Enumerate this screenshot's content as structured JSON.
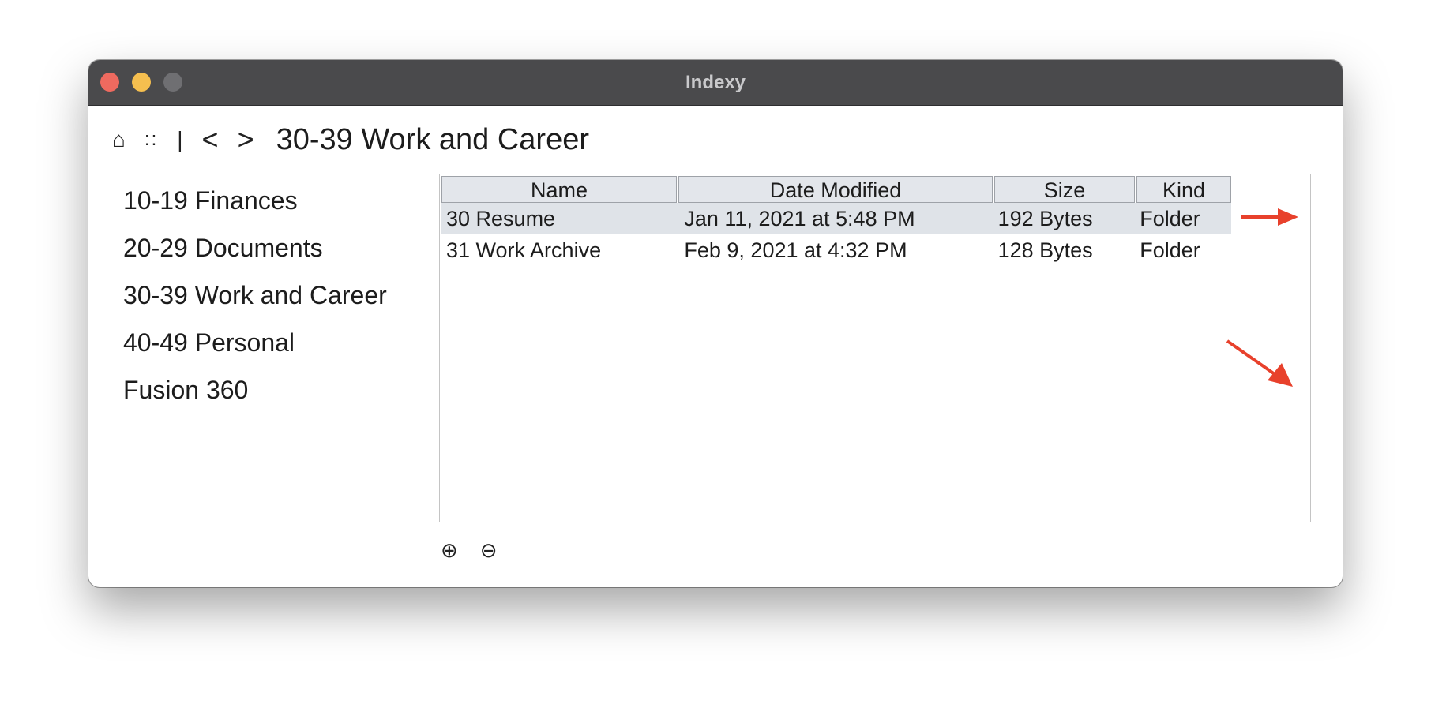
{
  "window": {
    "title": "Indexy"
  },
  "toolbar": {
    "home_glyph": "⌂",
    "grid_glyph": "::",
    "separator_glyph": "|",
    "back_glyph": "<",
    "forward_glyph": ">",
    "current_path": "30-39 Work and Career"
  },
  "sidebar": {
    "items": [
      {
        "label": "10-19 Finances"
      },
      {
        "label": "20-29 Documents"
      },
      {
        "label": "30-39 Work and Career"
      },
      {
        "label": "40-49 Personal"
      },
      {
        "label": "Fusion 360"
      }
    ]
  },
  "table": {
    "columns": [
      "Name",
      "Date Modified",
      "Size",
      "Kind"
    ],
    "rows": [
      {
        "name": "30 Resume",
        "date": "Jan 11, 2021 at 5:48 PM",
        "size": "192 Bytes",
        "kind": "Folder",
        "selected": true
      },
      {
        "name": "31 Work Archive",
        "date": "Feb 9, 2021 at 4:32 PM",
        "size": "128 Bytes",
        "kind": "Folder",
        "selected": false
      }
    ]
  },
  "footer": {
    "add_glyph": "⊕",
    "remove_glyph": "⊖"
  },
  "colors": {
    "annotation_arrow": "#e8412c",
    "titlebar": "#4a4a4c",
    "selected_row": "#dfe3e8",
    "header_bg": "#e3e6eb"
  }
}
